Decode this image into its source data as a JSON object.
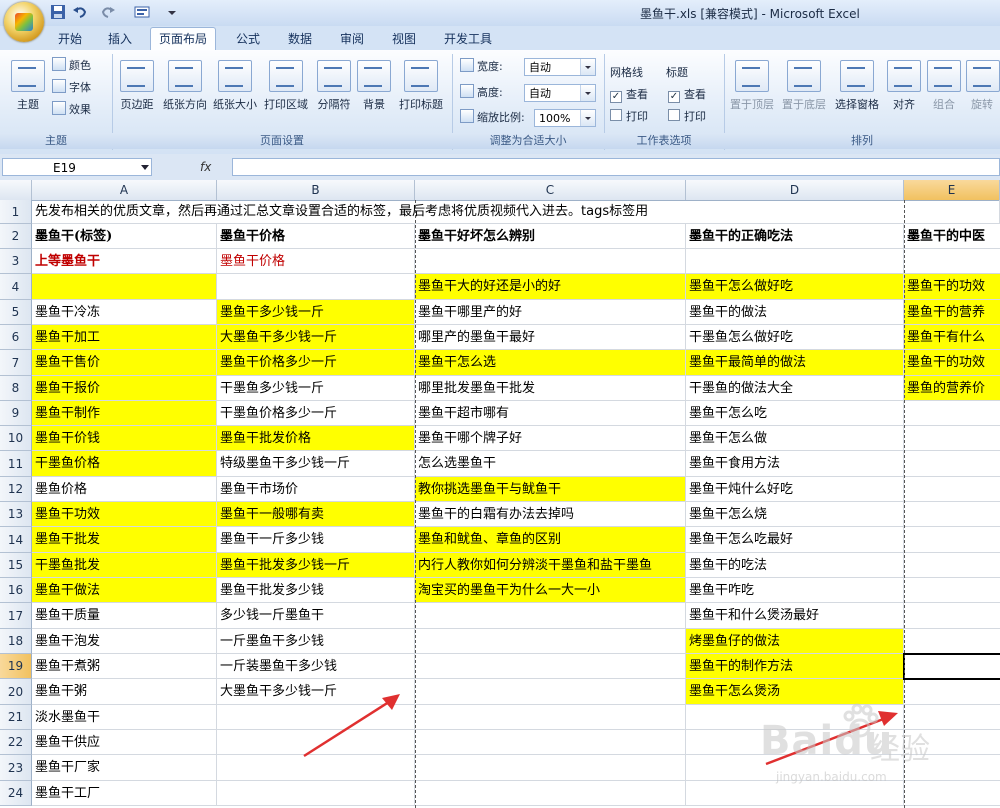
{
  "window": {
    "title": "墨鱼干.xls  [兼容模式] - Microsoft Excel"
  },
  "tabs": [
    {
      "label": "开始",
      "active": false
    },
    {
      "label": "插入",
      "active": false
    },
    {
      "label": "页面布局",
      "active": true
    },
    {
      "label": "公式",
      "active": false
    },
    {
      "label": "数据",
      "active": false
    },
    {
      "label": "审阅",
      "active": false
    },
    {
      "label": "视图",
      "active": false
    },
    {
      "label": "开发工具",
      "active": false
    }
  ],
  "ribbon": {
    "theme_group": {
      "label": "主题",
      "theme_button": "主题",
      "colors": "颜色",
      "fonts": "字体",
      "effects": "效果"
    },
    "page_setup_group": {
      "label": "页面设置",
      "buttons": [
        "页边距",
        "纸张方向",
        "纸张大小",
        "打印区域",
        "分隔符",
        "背景",
        "打印标题"
      ]
    },
    "scale_group": {
      "label": "调整为合适大小",
      "width_label": "宽度:",
      "width_value": "自动",
      "height_label": "高度:",
      "height_value": "自动",
      "scale_label": "缩放比例:",
      "scale_value": "100%"
    },
    "sheet_options_group": {
      "label": "工作表选项",
      "gridlines": "网格线",
      "headings": "标题",
      "view": "查看",
      "print": "打印"
    },
    "arrange_group": {
      "label": "排列",
      "buttons": [
        "置于顶层",
        "置于底层",
        "选择窗格",
        "对齐",
        "组合",
        "旋转"
      ]
    }
  },
  "formula_bar": {
    "name_box": "E19",
    "fx": "fx",
    "value": ""
  },
  "columns": [
    "A",
    "B",
    "C",
    "D",
    "E"
  ],
  "rows": [
    "1",
    "2",
    "3",
    "4",
    "5",
    "6",
    "7",
    "8",
    "9",
    "10",
    "11",
    "12",
    "13",
    "14",
    "15",
    "16",
    "17",
    "18",
    "19",
    "20",
    "21",
    "22",
    "23",
    "24"
  ],
  "cells": {
    "row1": "先发布相关的优质文章，然后再通过汇总文章设置合适的标签，最后考虑将优质视频代入进去。tags标签用",
    "headers": [
      "墨鱼干(标签)",
      "墨鱼干价格",
      "墨鱼干好坏怎么辨别",
      "墨鱼干的正确吃法",
      "墨鱼干的中医"
    ],
    "row3": [
      "上等墨鱼干",
      "墨鱼干价格"
    ],
    "colA": [
      "",
      "墨鱼干冷冻",
      "墨鱼干加工",
      "墨鱼干售价",
      "墨鱼干报价",
      "墨鱼干制作",
      "墨鱼干价钱",
      "干墨鱼价格",
      "墨鱼价格",
      "墨鱼干功效",
      "墨鱼干批发",
      "干墨鱼批发",
      "墨鱼干做法",
      "墨鱼干质量",
      "墨鱼干泡发",
      "墨鱼干煮粥",
      "墨鱼干粥",
      "淡水墨鱼干",
      "墨鱼干供应",
      "墨鱼干厂家",
      "墨鱼干工厂"
    ],
    "colB": [
      "",
      "墨鱼干多少钱一斤",
      "大墨鱼干多少钱一斤",
      "墨鱼干价格多少一斤",
      "干墨鱼多少钱一斤",
      "干墨鱼价格多少一斤",
      "墨鱼干批发价格",
      "特级墨鱼干多少钱一斤",
      "墨鱼干市场价",
      "墨鱼干一般哪有卖",
      "墨鱼干一斤多少钱",
      "墨鱼干批发多少钱一斤",
      "墨鱼干批发多少钱",
      "多少钱一斤墨鱼干",
      "一斤墨鱼干多少钱",
      "一斤装墨鱼干多少钱",
      "大墨鱼干多少钱一斤"
    ],
    "colC": [
      "墨鱼干大的好还是小的好",
      "墨鱼干哪里产的好",
      "哪里产的墨鱼干最好",
      "墨鱼干怎么选",
      "哪里批发墨鱼干批发",
      "墨鱼干超市哪有",
      "墨鱼干哪个牌子好",
      "怎么选墨鱼干",
      "教你挑选墨鱼干与鱿鱼干",
      "墨鱼干的白霜有办法去掉吗",
      "墨鱼和鱿鱼、章鱼的区别",
      "内行人教你如何分辨淡干墨鱼和盐干墨鱼",
      "淘宝买的墨鱼干为什么一大一小"
    ],
    "colD": [
      "墨鱼干怎么做好吃",
      "墨鱼干的做法",
      "干墨鱼怎么做好吃",
      "墨鱼干最简单的做法",
      "干墨鱼的做法大全",
      "墨鱼干怎么吃",
      "墨鱼干怎么做",
      "墨鱼干食用方法",
      "墨鱼干炖什么好吃",
      "墨鱼干怎么烧",
      "墨鱼干怎么吃最好",
      "墨鱼干的吃法",
      "墨鱼干咋吃",
      "墨鱼干和什么煲汤最好",
      "烤墨鱼仔的做法",
      "墨鱼干的制作方法",
      "墨鱼干怎么煲汤"
    ],
    "colE": [
      "墨鱼干的功效",
      "墨鱼干的营养",
      "墨鱼干有什么",
      "墨鱼干的功效",
      "墨鱼的营养价"
    ]
  },
  "watermark": {
    "brand": "Baidu",
    "product": "经验",
    "url": "jingyan.baidu.com"
  },
  "colors": {
    "highlight": "#ffff00",
    "red_text": "#c00000",
    "arrow": "#e03030"
  }
}
